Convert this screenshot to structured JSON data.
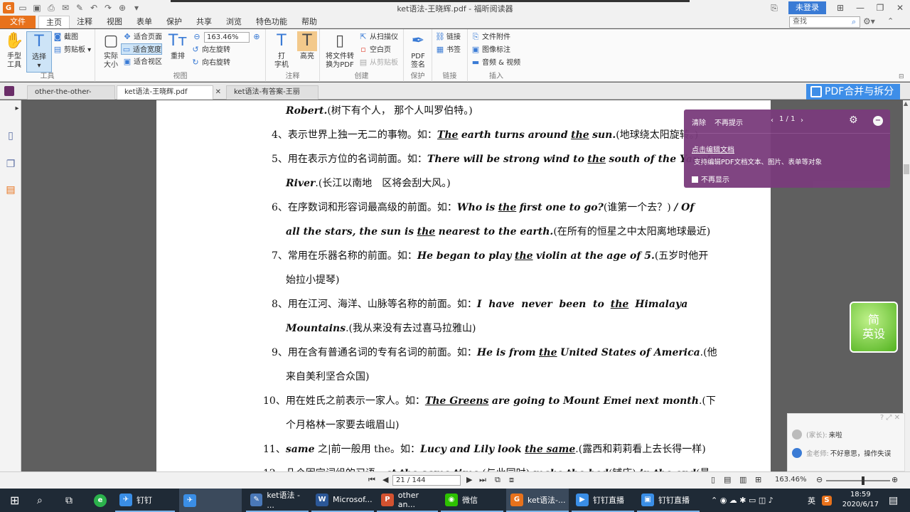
{
  "window": {
    "title": "ket语法-王晓辉.pdf - 福昕阅读器",
    "login": "未登录"
  },
  "menu": {
    "file": "文件",
    "tabs": [
      "主页",
      "注释",
      "视图",
      "表单",
      "保护",
      "共享",
      "浏览",
      "特色功能",
      "帮助"
    ],
    "search_placeholder": "查找"
  },
  "ribbon": {
    "hand_tool": "手型\n工具",
    "select": "选择",
    "screenshot": "截图",
    "clipboard": "剪贴板",
    "group_tools": "工具",
    "actual_size": "实际\n大小",
    "fit_page": "适合页面",
    "fit_width": "适合宽度",
    "fit_visible": "适合视区",
    "reflow": "重排",
    "zoom": "163.46%",
    "rotate_left": "向左旋转",
    "rotate_right": "向右旋转",
    "group_view": "视图",
    "typewriter": "打\n字机",
    "highlight": "高亮",
    "group_comment": "注释",
    "to_pdf": "将文件转\n换为PDF",
    "from_scanner": "从扫描仪",
    "blank_page": "空白页",
    "from_clipboard": "从剪贴板",
    "group_create": "创建",
    "pdf_sign": "PDF\n签名",
    "group_protect": "保护",
    "link": "链接",
    "bookmark": "书签",
    "group_links": "链接",
    "attachment": "文件附件",
    "image_annot": "图像标注",
    "audio_video": "音频 & 视频",
    "group_insert": "插入"
  },
  "doctabs": {
    "tab1": "other-the-other-anothe...",
    "tab2": "ket语法-王晓辉.pdf",
    "tab3": "ket语法-有答案-王丽婷...",
    "merge": "PDF合并与拆分"
  },
  "doc": {
    "lines": [
      {
        "num": "",
        "html": "<b>Robert.</b>(树下有个人， 那个人叫罗伯特。)"
      },
      {
        "num": "4、",
        "html": "表示世界上独一无二的事物。如：<u>The</u> <b>earth turns around</b> <u>the</u> <b>sun.</b>(地球绕太阳旋转。)"
      },
      {
        "num": "5、",
        "html": "用在表示方位的名词前面。如：<b>There will be strong wind to</b> <u>the</u> <b>south of the Yangtze</b>"
      },
      {
        "num": "",
        "html": "<b>River</b>.(长江以南地　区将会刮大风。)"
      },
      {
        "num": "6、",
        "html": "在序数词和形容词最高级的前面。如：<b>Who is</b> <u>the</u> <b>first one to go?</b>(谁第一个去？) <b>/ Of</b>"
      },
      {
        "num": "",
        "html": "<b>all the stars, the sun is</b> <u>the</u> <b>nearest to the earth.</b>(在所有的恒星之中太阳离地球最近)"
      },
      {
        "num": "7、",
        "html": "常用在乐器名称的前面。如：<b>He began to play</b> <u>the</u> <b>violin at the age of 5.</b>(五岁时他开"
      },
      {
        "num": "",
        "html": "始拉小提琴)"
      },
      {
        "num": "8、",
        "html": "用在江河、海洋、山脉等名称的前面。如：<b>I&nbsp; have&nbsp; never&nbsp; been&nbsp; to</b>&nbsp; <u>the</u>&nbsp; <b>Himalaya</b>"
      },
      {
        "num": "",
        "html": "<b>Mountains</b>.(我从来没有去过喜马拉雅山)"
      },
      {
        "num": "9、",
        "html": "用在含有普通名词的专有名词的前面。如：<b>He is from</b> <u>the</u> <b>United States of America</b>.(他"
      },
      {
        "num": "",
        "html": "来自美利坚合众国)"
      },
      {
        "num": "10、",
        "html": "用在姓氏之前表示一家人。如：<u>The Greens</u> <b>are going to Mount Emei next month</b>.(下"
      },
      {
        "num": "",
        "html": "个月格林一家要去峨眉山)"
      },
      {
        "num": "11、",
        "html": "<b>same</b> 之|前一般用 the。如：<b>Lucy and Lily look</b> <u>the same</u>.(露西和莉莉看上去长得一样)"
      },
      {
        "num": "12、",
        "html": "几个固定词组的习语。<b>at the same time</b> (与此同时) <b>make the bed</b>(铺床) <b>in the end</b>(最"
      }
    ]
  },
  "tip": {
    "clear": "清除",
    "no_more": "不再提示",
    "pager": "1 / 1",
    "link": "点击编辑文档",
    "desc": "支持编辑PDF文档文本、图片、表单等对象",
    "dont_show": "不再显示"
  },
  "floatapp": {
    "line1": "简",
    "line2": "英设"
  },
  "chat": {
    "msg1_who": "(家长):",
    "msg1": "来啦",
    "msg2_who": "金老师:",
    "msg2": "不好意思，操作失误"
  },
  "status": {
    "page": "21 / 144",
    "zoom": "163.46%"
  },
  "taskbar": {
    "dingding": "钉钉",
    "item1": "ket语法 - ...",
    "item2": "Microsof...",
    "item3": "other an...",
    "wechat": "微信",
    "item5": "ket语法-...",
    "live1": "钉钉直播",
    "live2": "钉钉直播",
    "lang": "英",
    "time": "18:59",
    "date": "2020/6/17"
  },
  "colors": {
    "accent_orange": "#e8721c",
    "tip_purple": "#7a3c7c",
    "merge_blue": "#3e8ee8",
    "taskbar": "#1f2a36"
  }
}
